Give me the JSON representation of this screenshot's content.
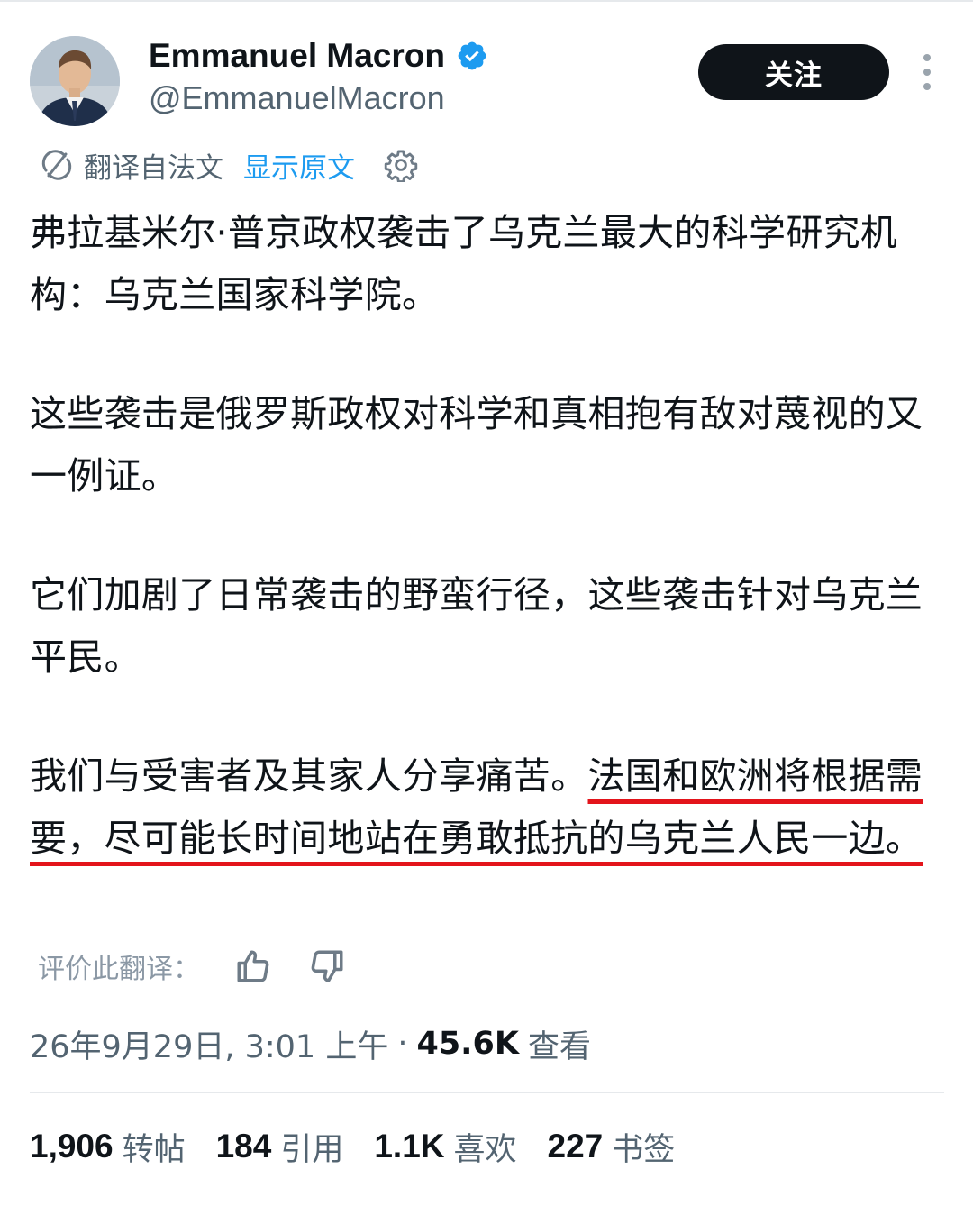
{
  "author": {
    "display_name": "Emmanuel Macron",
    "handle": "@EmmanuelMacron",
    "verified": true,
    "verified_badge_color": "#1d9bf0"
  },
  "actions": {
    "follow_label": "关注",
    "more_icon": "more-vertical-icon"
  },
  "translation": {
    "label": "翻译自法文",
    "show_original_label": "显示原文",
    "icon": "translate-icon",
    "settings_icon": "gear-icon"
  },
  "tweet": {
    "paragraphs": [
      {
        "text": "弗拉基米尔·普京政权袭击了乌克兰最大的科学研究机构：乌克兰国家科学院。",
        "highlight": ""
      },
      {
        "text": "这些袭击是俄罗斯政权对科学和真相抱有敌对蔑视的又一例证。",
        "highlight": ""
      },
      {
        "text": "它们加剧了日常袭击的野蛮行径，这些袭击针对乌克兰平民。",
        "highlight": ""
      },
      {
        "text": "我们与受害者及其家人分享痛苦。",
        "highlight": "法国和欧洲将根据需要，尽可能长时间地站在勇敢抵抗的乌克兰人民一边。"
      }
    ],
    "highlight_color": "#e3141b"
  },
  "rating": {
    "label": "评价此翻译：",
    "up_icon": "thumbs-up-icon",
    "down_icon": "thumbs-down-icon"
  },
  "meta": {
    "timestamp": "26年9月29日, 3:01 上午",
    "separator": "·",
    "views_count": "45.6K",
    "views_label": "查看"
  },
  "stats": [
    {
      "value": "1,906",
      "label": "转帖"
    },
    {
      "value": "184",
      "label": "引用"
    },
    {
      "value": "1.1K",
      "label": "喜欢"
    },
    {
      "value": "227",
      "label": "书签"
    }
  ],
  "colors": {
    "text_primary": "#0f1419",
    "text_secondary": "#536471",
    "link": "#1d9bf0",
    "follow_bg": "#0f1419"
  }
}
